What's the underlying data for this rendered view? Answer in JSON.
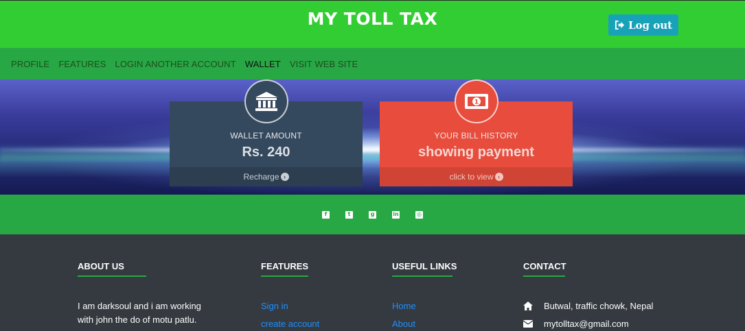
{
  "header": {
    "brand": "MY TOLL TAX",
    "logout_label": "Log out"
  },
  "nav": {
    "items": [
      "PROFILE",
      "FEATURES",
      "LOGIN ANOTHER ACCOUNT",
      "WALLET",
      "VISIT WEB SITE"
    ],
    "active": "WALLET"
  },
  "cards": {
    "wallet": {
      "icon": "bank-icon",
      "label": "WALLET AMOUNT",
      "value": "Rs. 240",
      "footer": "Recharge"
    },
    "bill": {
      "icon": "money-bill-icon",
      "label": "YOUR BILL HISTORY",
      "value": "showing payment",
      "footer": "click to view"
    }
  },
  "social": {
    "icons": [
      "facebook-icon",
      "twitter-icon",
      "google-plus-icon",
      "linkedin-icon",
      "instagram-icon"
    ]
  },
  "footer": {
    "about": {
      "heading": "ABOUT US",
      "text": "I am darksoul and i am working with john the do of motu patlu."
    },
    "features": {
      "heading": "FEATURES",
      "links": [
        "Sign in",
        "create account"
      ]
    },
    "useful_links": {
      "heading": "USEFUL LINKS",
      "links": [
        "Home",
        "About"
      ]
    },
    "contact": {
      "heading": "CONTACT",
      "address": "Butwal, traffic chowk, Nepal",
      "email": "mytolltax@gmail.com"
    }
  },
  "colors": {
    "topbar": "#32cd32",
    "navbar": "#28a745",
    "logout": "#17a2b8",
    "wallet_card": "#34495e",
    "bill_card": "#e74c3c",
    "footer": "#343a40",
    "link": "#1e90ff"
  }
}
